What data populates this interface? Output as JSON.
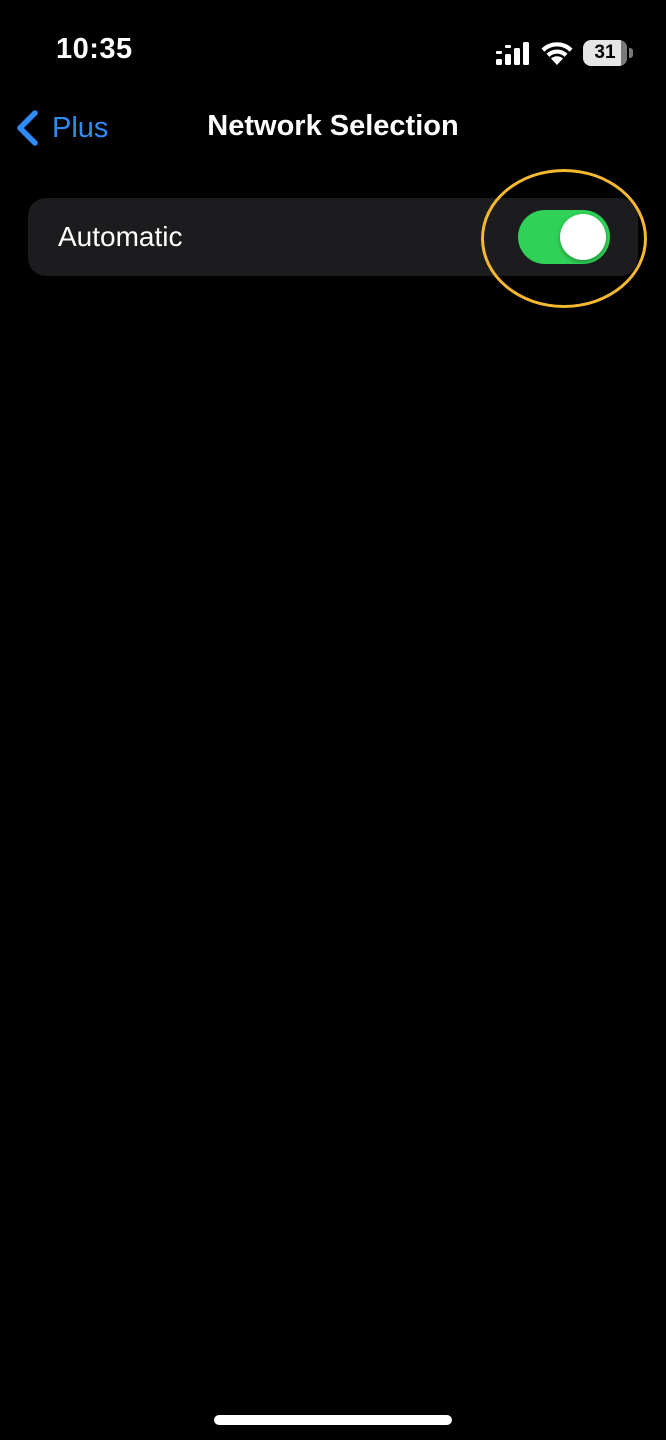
{
  "status_bar": {
    "time": "10:35",
    "battery_level": "31",
    "signal_icon": "cellular-signal-icon",
    "wifi_icon": "wifi-icon",
    "battery_icon": "battery-icon"
  },
  "nav": {
    "back_label": "Plus",
    "title": "Network Selection"
  },
  "settings": {
    "automatic_label": "Automatic",
    "automatic_enabled": true
  },
  "colors": {
    "background": "#000000",
    "cell_background": "#1c1c1e",
    "accent_blue": "#2f8cf6",
    "toggle_on": "#30d158",
    "highlight": "#f5b82e"
  }
}
